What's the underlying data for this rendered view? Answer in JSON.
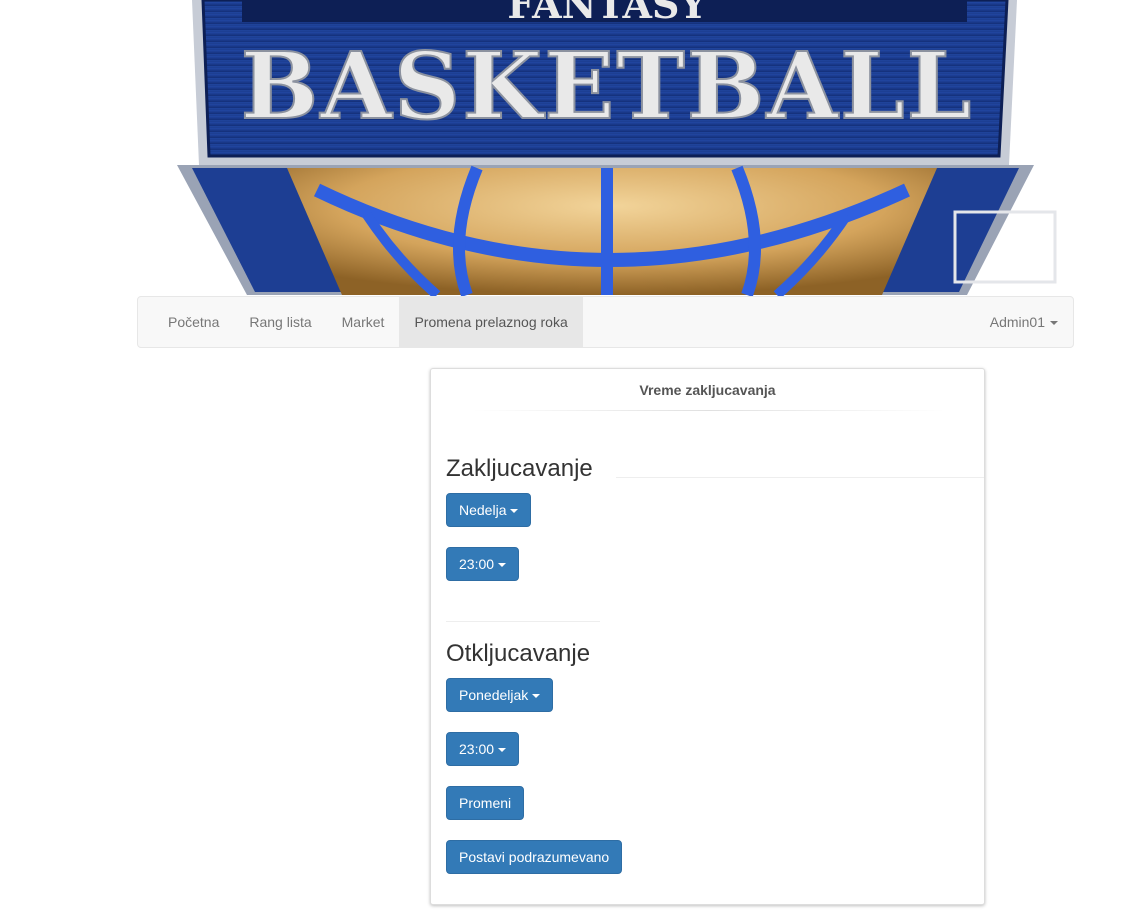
{
  "banner": {
    "logo_top_text": "FANTASY",
    "logo_main_text": "BASKETBALL",
    "colors": {
      "shield_blue": "#1b3f95",
      "shield_dark": "#0d1f55",
      "ball_orange": "#d4a45c",
      "seam_blue": "#2f5fe0",
      "letters": "#e9e9e9"
    }
  },
  "navbar": {
    "items": [
      {
        "label": "Početna"
      },
      {
        "label": "Rang lista"
      },
      {
        "label": "Market"
      },
      {
        "label": "Promena prelaznog roka",
        "active": true
      }
    ],
    "user_menu": {
      "label": "Admin01"
    }
  },
  "panel": {
    "title": "Vreme zakljucavanja",
    "lock": {
      "heading": "Zakljucavanje",
      "day": "Nedelja",
      "time": "23:00"
    },
    "unlock": {
      "heading": "Otkljucavanje",
      "day": "Ponedeljak",
      "time": "23:00"
    },
    "buttons": {
      "change": "Promeni",
      "reset_default": "Postavi podrazumevano"
    },
    "colors": {
      "button_primary": "#337ab7"
    }
  }
}
